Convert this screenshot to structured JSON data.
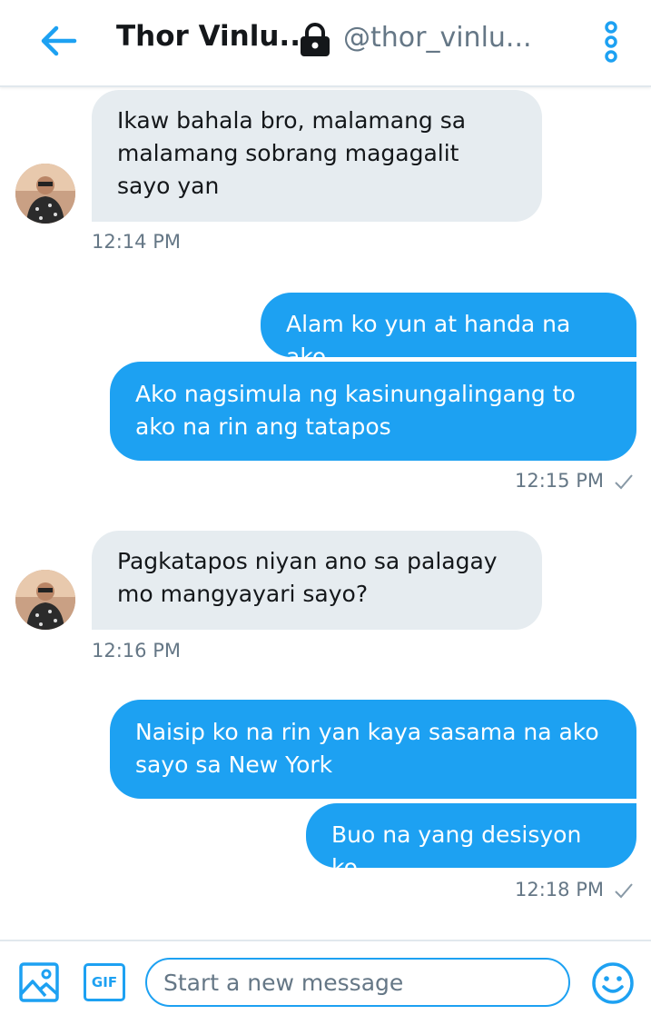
{
  "header": {
    "title": "Thor Vinlu...",
    "handle": "@thor_vinlu..."
  },
  "messages": [
    {
      "direction": "incoming",
      "text": "Ikaw bahala bro, malamang sa malamang sobrang magagalit sayo yan",
      "time": "12:14 PM"
    },
    {
      "direction": "outgoing",
      "text": "Alam ko yun at handa na ako"
    },
    {
      "direction": "outgoing",
      "text": "Ako nagsimula ng kasinungalingang to ako na rin ang tatapos",
      "time": "12:15 PM",
      "status": "sent"
    },
    {
      "direction": "incoming",
      "text": "Pagkatapos niyan ano sa palagay mo mangyayari sayo?",
      "time": "12:16 PM"
    },
    {
      "direction": "outgoing",
      "text": "Naisip ko na rin yan kaya sasama na ako sayo sa New York"
    },
    {
      "direction": "outgoing",
      "text": "Buo na yang desisyon ko",
      "time": "12:18 PM",
      "status": "sent"
    }
  ],
  "composer": {
    "placeholder": "Start a new message",
    "gif_label": "GIF"
  },
  "colors": {
    "accent": "#1da1f2",
    "incoming_bubble": "#e6ecf0",
    "muted_text": "#657786"
  },
  "icons": [
    "back-arrow-icon",
    "lock-icon",
    "more-vertical-icon",
    "image-icon",
    "gif-icon",
    "emoji-icon",
    "checkmark-icon"
  ]
}
